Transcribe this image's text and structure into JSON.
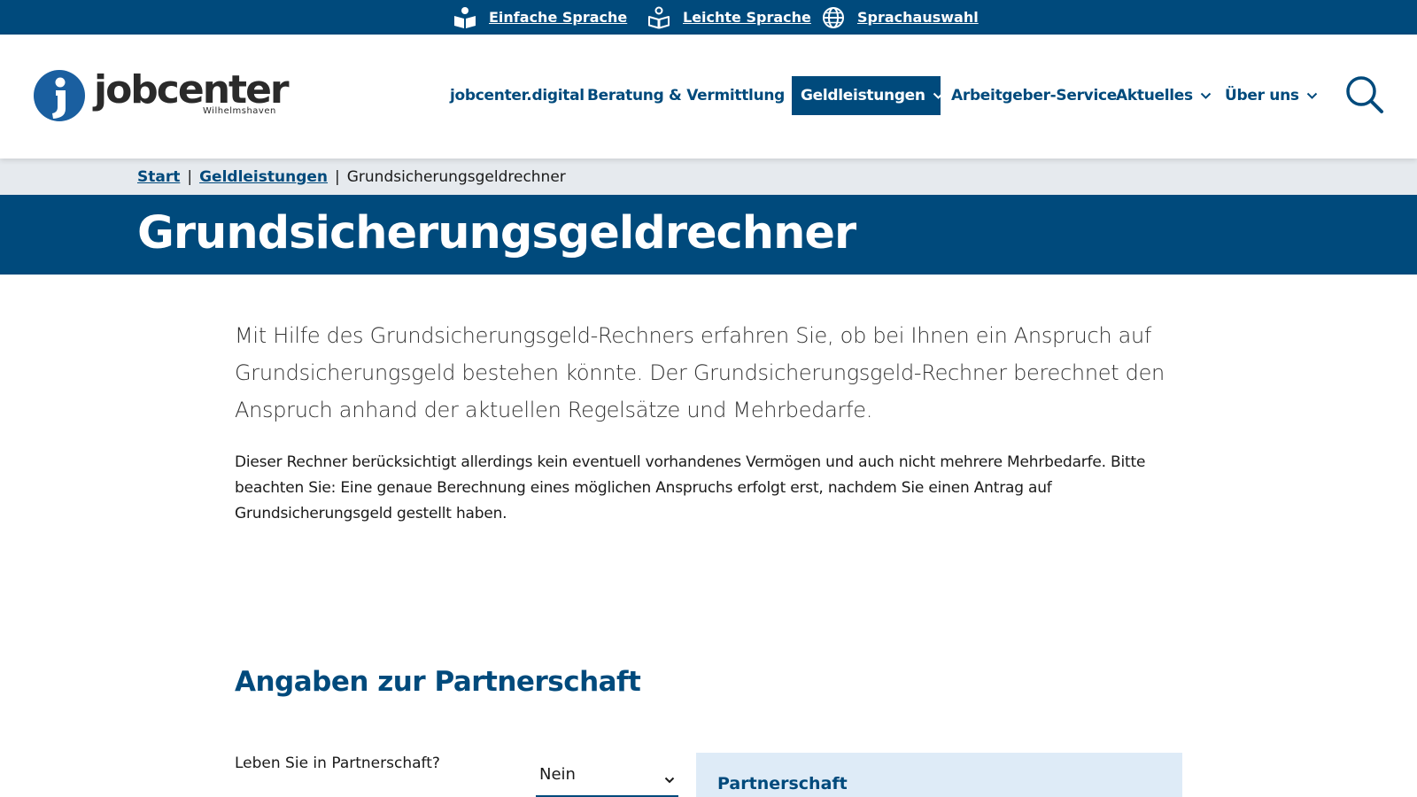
{
  "topbar": {
    "items": [
      {
        "label": "Einfache Sprache",
        "icon": "book-person-icon"
      },
      {
        "label": "Leichte Sprache",
        "icon": "book-outline-icon"
      },
      {
        "label": "Sprachauswahl",
        "icon": "globe-icon"
      }
    ]
  },
  "header": {
    "logo": {
      "wordmark": "jobcenter",
      "subtitle": "Wilhelmshaven"
    },
    "nav": [
      {
        "label": "jobcenter.digital",
        "has_dropdown": false
      },
      {
        "label": "Beratung & Vermittlung",
        "has_dropdown": true
      },
      {
        "label": "Geldleistungen",
        "has_dropdown": true,
        "active": true
      },
      {
        "label": "Arbeitgeber-Service",
        "has_dropdown": false
      },
      {
        "label": "Aktuelles",
        "has_dropdown": true
      },
      {
        "label": "Über uns",
        "has_dropdown": true
      }
    ],
    "search_icon": "search-icon"
  },
  "breadcrumb": {
    "items": [
      "Start",
      "Geldleistungen",
      "Grundsicherungsgeldrechner"
    ],
    "separator": "|"
  },
  "page": {
    "title": "Grundsicherungsgeldrechner",
    "lead": "Mit Hilfe des Grundsicherungsgeld-Rechners erfahren Sie, ob bei Ihnen ein Anspruch auf Grundsicherungsgeld bestehen könnte. Der Grundsicherungsgeld-Rechner berechnet den Anspruch anhand der aktuellen Regelsätze und Mehrbedarfe.",
    "body": "Dieser Rechner berücksichtigt allerdings kein eventuell vorhandenes Vermögen und auch nicht mehrere Mehrbedarfe. Bitte beachten Sie: Eine genaue Berechnung eines möglichen Anspruchs erfolgt erst, nachdem Sie einen Antrag auf Grundsicherungsgeld gestellt haben."
  },
  "form": {
    "section_title": "Angaben zur Partnerschaft",
    "partnership_label": "Leben Sie in Partnerschaft?",
    "partnership_value": "Nein",
    "info_box_title": "Partnerschaft"
  },
  "colors": {
    "brand": "#004a7c",
    "breadcrumb_bg": "#e6eaee",
    "info_bg": "#deebf7"
  }
}
